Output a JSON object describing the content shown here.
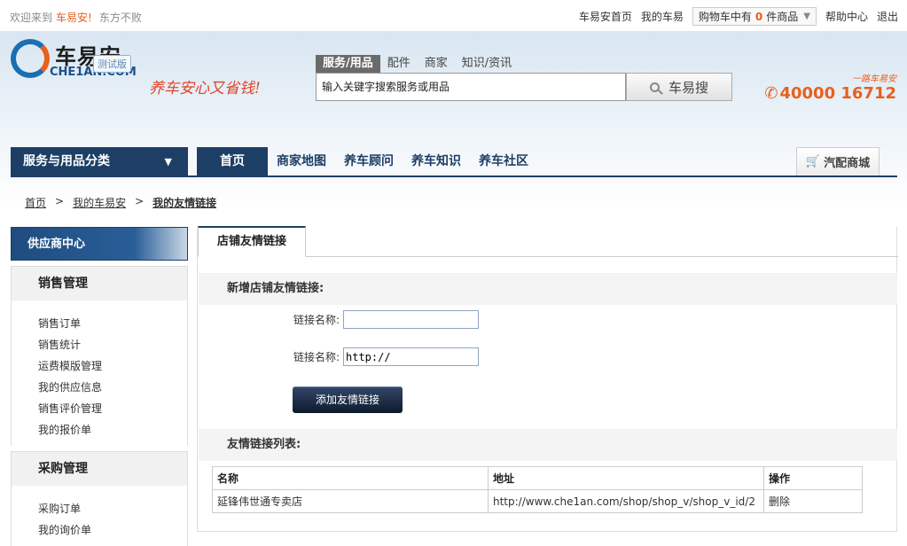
{
  "topbar": {
    "welcome": "欢迎来到",
    "brand": "车易安!",
    "user": "东方不败",
    "links": [
      "车易安首页",
      "我的车易"
    ],
    "cart": {
      "prefix": "购物车中有",
      "count": "0",
      "suffix": "件商品"
    },
    "help": "帮助中心",
    "logout": "退出"
  },
  "logo": {
    "cn": "车易安",
    "en": "CHE1AN.COM",
    "beta": "测试版",
    "slogan": "养车安心又省钱!"
  },
  "search": {
    "tabs": [
      "服务/用品",
      "配件",
      "商家",
      "知识/资讯"
    ],
    "value": "输入关键字搜索服务或用品",
    "button": "车易搜"
  },
  "hotline": {
    "caption": "一路车易安",
    "number": "40000 16712"
  },
  "nav": {
    "category": "服务与用品分类",
    "items": [
      "首页",
      "商家地图",
      "养车顾问",
      "养车知识",
      "养车社区"
    ],
    "mall": "汽配商城"
  },
  "breadcrumb": [
    "首页",
    "我的车易安",
    "我的友情链接"
  ],
  "sidebar": {
    "title": "供应商中心",
    "groups": [
      {
        "title": "销售管理",
        "items": [
          "销售订单",
          "销售统计",
          "运费模版管理",
          "我的供应信息",
          "销售评价管理",
          "我的报价单"
        ]
      },
      {
        "title": "采购管理",
        "items": [
          "采购订单",
          "我的询价单"
        ]
      }
    ]
  },
  "content": {
    "tab": "店铺友情链接",
    "add_section": "新增店铺友情链接:",
    "field1_label": "链接名称:",
    "field1_value": "",
    "field2_label": "链接名称:",
    "field2_value": "http://",
    "add_button": "添加友情链接",
    "list_section": "友情链接列表:",
    "table": {
      "headers": [
        "名称",
        "地址",
        "操作"
      ],
      "rows": [
        [
          "延锋伟世通专卖店",
          "http://www.che1an.com/shop/shop_v/shop_v_id/2",
          "删除"
        ]
      ]
    }
  },
  "colors": {
    "accent": "#e8601c",
    "nav": "#1d3f66"
  }
}
